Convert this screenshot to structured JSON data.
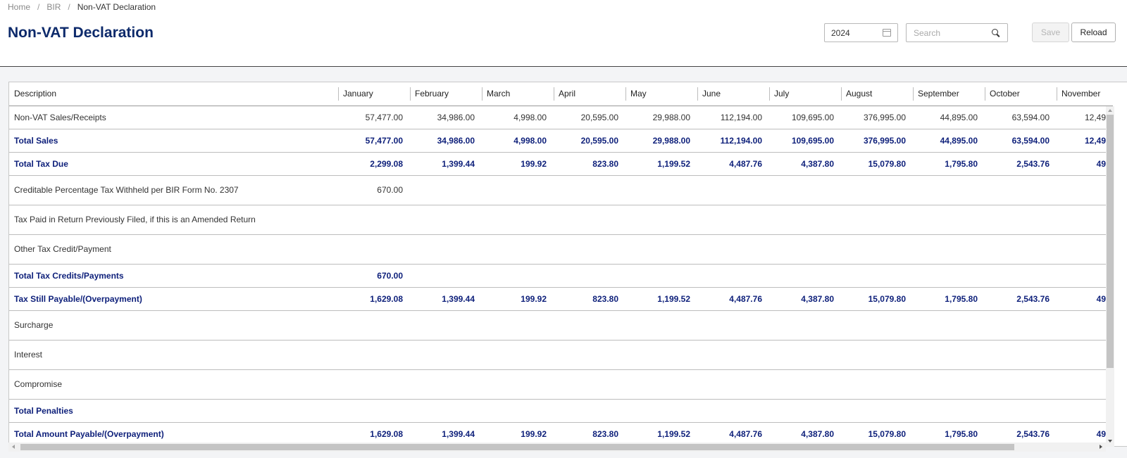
{
  "breadcrumb": {
    "home": "Home",
    "section": "BIR",
    "current": "Non-VAT Declaration",
    "separator": "/"
  },
  "page": {
    "title": "Non-VAT Declaration"
  },
  "toolbar": {
    "year_value": "2024",
    "search_placeholder": "Search",
    "save_label": "Save",
    "reload_label": "Reload"
  },
  "colors": {
    "title": "#0d2a6b",
    "total_row_text": "#0d1f7a",
    "save_disabled_text": "#b5b5b5"
  },
  "table": {
    "columns": [
      "Description",
      "January",
      "February",
      "March",
      "April",
      "May",
      "June",
      "July",
      "August",
      "September",
      "October",
      "November"
    ],
    "rows": [
      {
        "type": "normal",
        "cells": [
          "Non-VAT Sales/Receipts",
          "57,477.00",
          "34,986.00",
          "4,998.00",
          "20,595.00",
          "29,988.00",
          "112,194.00",
          "109,695.00",
          "376,995.00",
          "44,895.00",
          "63,594.00",
          "12,49"
        ]
      },
      {
        "type": "total",
        "cells": [
          "Total Sales",
          "57,477.00",
          "34,986.00",
          "4,998.00",
          "20,595.00",
          "29,988.00",
          "112,194.00",
          "109,695.00",
          "376,995.00",
          "44,895.00",
          "63,594.00",
          "12,49"
        ]
      },
      {
        "type": "total",
        "cells": [
          "Total Tax Due",
          "2,299.08",
          "1,399.44",
          "199.92",
          "823.80",
          "1,199.52",
          "4,487.76",
          "4,387.80",
          "15,079.80",
          "1,795.80",
          "2,543.76",
          "49"
        ]
      },
      {
        "type": "normal",
        "cells": [
          "Creditable Percentage Tax Withheld per BIR Form No. 2307",
          "670.00",
          "",
          "",
          "",
          "",
          "",
          "",
          "",
          "",
          "",
          ""
        ]
      },
      {
        "type": "normal",
        "cells": [
          "Tax Paid in Return Previously Filed, if this is an Amended Return",
          "",
          "",
          "",
          "",
          "",
          "",
          "",
          "",
          "",
          "",
          ""
        ]
      },
      {
        "type": "normal",
        "cells": [
          "Other Tax Credit/Payment",
          "",
          "",
          "",
          "",
          "",
          "",
          "",
          "",
          "",
          "",
          ""
        ]
      },
      {
        "type": "total",
        "cells": [
          "Total Tax Credits/Payments",
          "670.00",
          "",
          "",
          "",
          "",
          "",
          "",
          "",
          "",
          "",
          ""
        ]
      },
      {
        "type": "total",
        "cells": [
          "Tax Still Payable/(Overpayment)",
          "1,629.08",
          "1,399.44",
          "199.92",
          "823.80",
          "1,199.52",
          "4,487.76",
          "4,387.80",
          "15,079.80",
          "1,795.80",
          "2,543.76",
          "49"
        ]
      },
      {
        "type": "normal",
        "cells": [
          "Surcharge",
          "",
          "",
          "",
          "",
          "",
          "",
          "",
          "",
          "",
          "",
          ""
        ]
      },
      {
        "type": "normal",
        "cells": [
          "Interest",
          "",
          "",
          "",
          "",
          "",
          "",
          "",
          "",
          "",
          "",
          ""
        ]
      },
      {
        "type": "normal",
        "cells": [
          "Compromise",
          "",
          "",
          "",
          "",
          "",
          "",
          "",
          "",
          "",
          "",
          ""
        ]
      },
      {
        "type": "total",
        "cells": [
          "Total Penalties",
          "",
          "",
          "",
          "",
          "",
          "",
          "",
          "",
          "",
          "",
          ""
        ]
      },
      {
        "type": "total",
        "cells": [
          "Total Amount Payable/(Overpayment)",
          "1,629.08",
          "1,399.44",
          "199.92",
          "823.80",
          "1,199.52",
          "4,487.76",
          "4,387.80",
          "15,079.80",
          "1,795.80",
          "2,543.76",
          "49"
        ]
      }
    ]
  }
}
